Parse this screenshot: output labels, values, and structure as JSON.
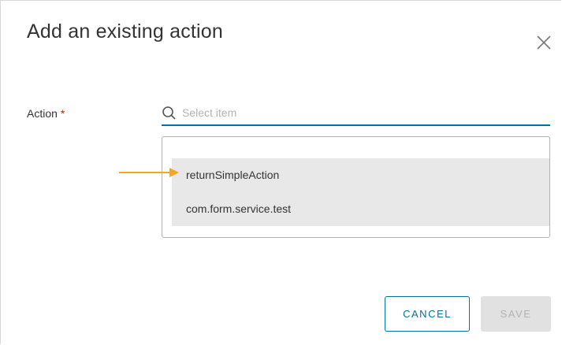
{
  "dialog": {
    "title": "Add an existing action",
    "close_icon": "close-icon"
  },
  "form": {
    "action_label": "Action",
    "required_marker": "*",
    "search": {
      "icon": "search-icon",
      "placeholder": "Select item",
      "value": ""
    }
  },
  "dropdown": {
    "items": [
      {
        "label": "returnSimpleAction"
      },
      {
        "label": "com.form.service.test"
      }
    ]
  },
  "annotation": {
    "arrow_icon": "arrow-right-icon",
    "arrow_color": "#f5a623"
  },
  "footer": {
    "cancel_label": "CANCEL",
    "save_label": "SAVE",
    "save_enabled": false
  },
  "colors": {
    "accent": "#0072a3",
    "required": "#c92100",
    "selected_bg": "#e8e8e8",
    "disabled_bg": "#e1e1e1"
  }
}
